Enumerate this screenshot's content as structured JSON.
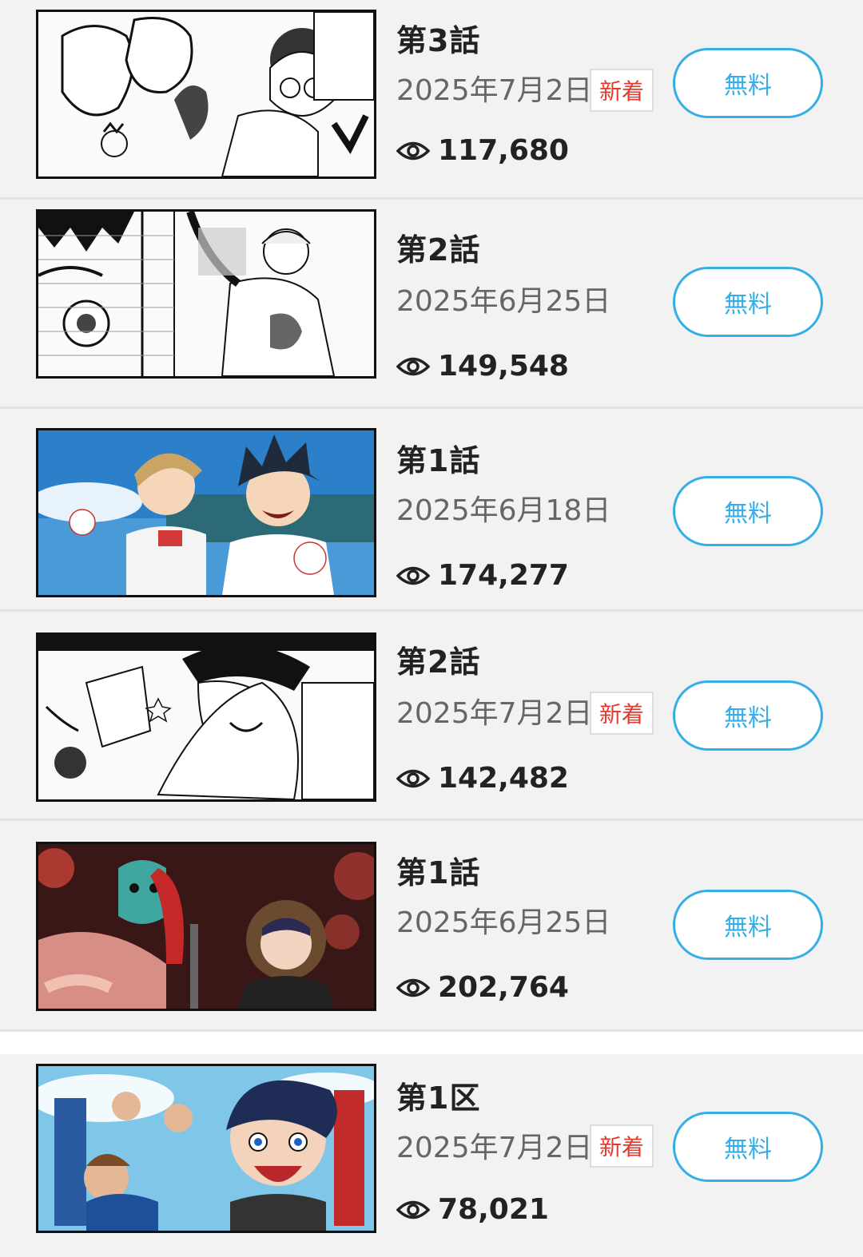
{
  "colors": {
    "accent": "#34aee4",
    "new_badge": "#e23b2e",
    "row_bg": "#f2f2f2"
  },
  "episodes": [
    {
      "title": "第3話",
      "date": "2025年7月2日",
      "badge": "新着",
      "views": "117,680",
      "button": "無料",
      "thumb_style": "manga-bw"
    },
    {
      "title": "第2話",
      "date": "2025年6月25日",
      "badge": "",
      "views": "149,548",
      "button": "無料",
      "thumb_style": "manga-bw"
    },
    {
      "title": "第1話",
      "date": "2025年6月18日",
      "badge": "",
      "views": "174,277",
      "button": "無料",
      "thumb_style": "color-blue"
    },
    {
      "title": "第2話",
      "date": "2025年7月2日",
      "badge": "新着",
      "views": "142,482",
      "button": "無料",
      "thumb_style": "manga-bw"
    },
    {
      "title": "第1話",
      "date": "2025年6月25日",
      "badge": "",
      "views": "202,764",
      "button": "無料",
      "thumb_style": "color-red"
    },
    {
      "title": "第1区",
      "date": "2025年7月2日",
      "badge": "新着",
      "views": "78,021",
      "button": "無料",
      "thumb_style": "color-sky"
    }
  ],
  "icons": {
    "views": "eye-icon"
  }
}
